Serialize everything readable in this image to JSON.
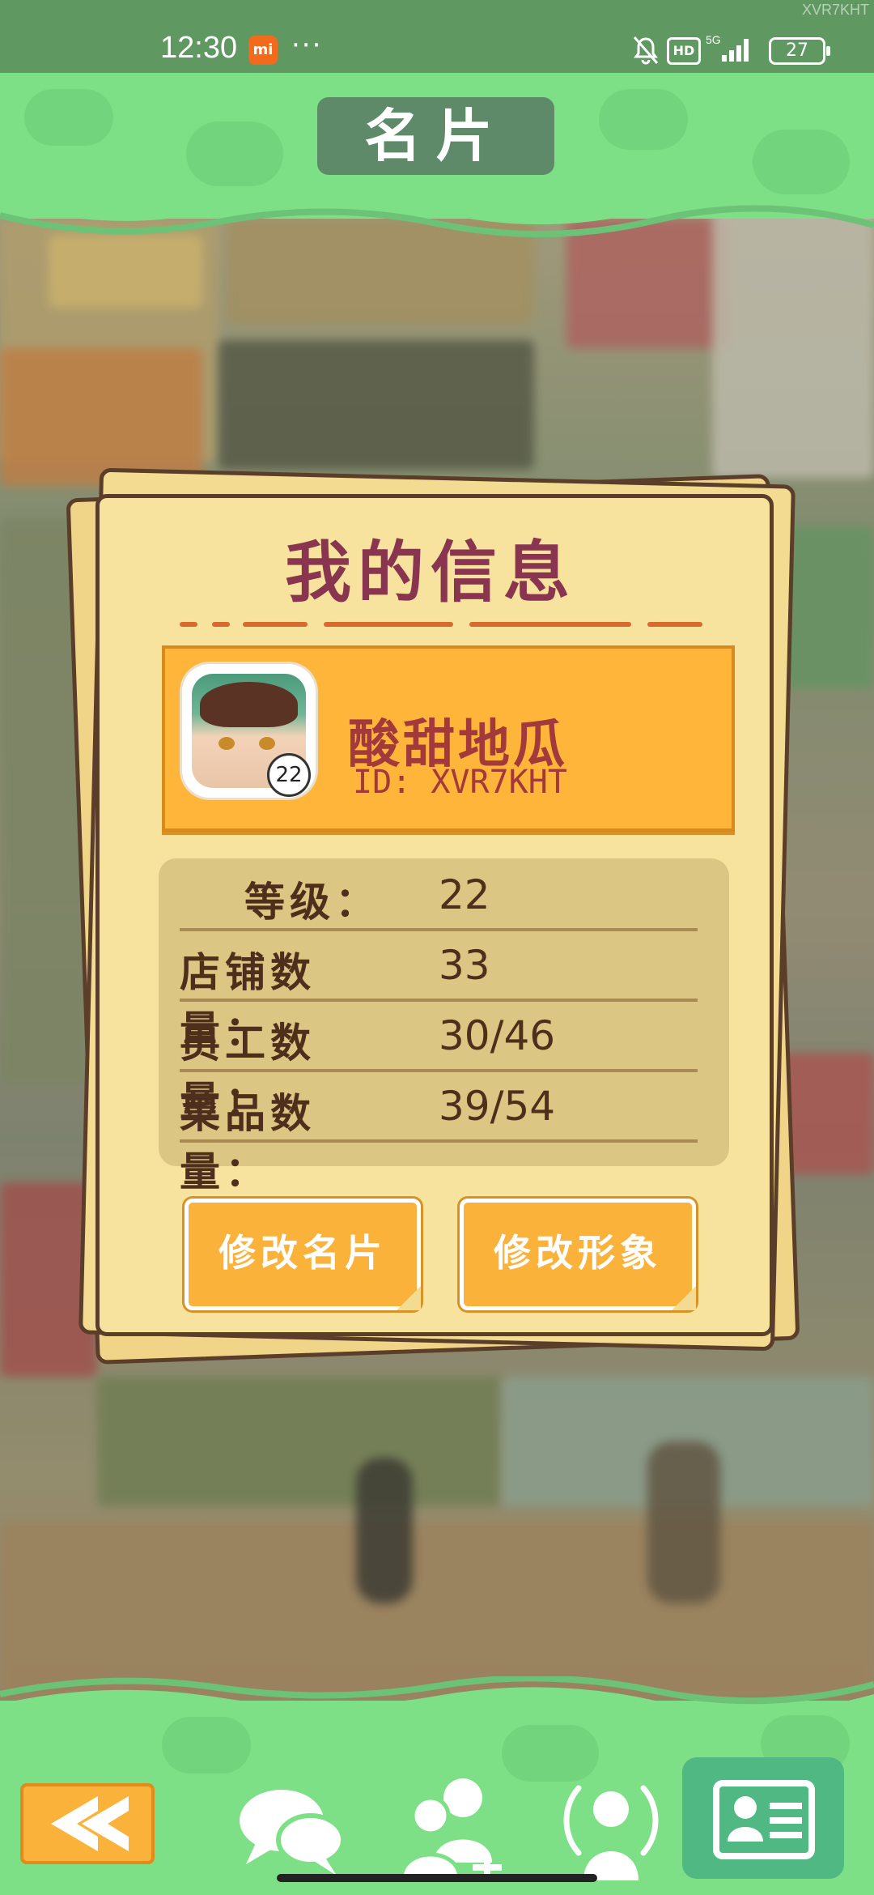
{
  "status_bar": {
    "time": "12:30",
    "app_badge": "mi",
    "more": "···",
    "hd": "HD",
    "network": "5G",
    "battery": "27"
  },
  "watermark": "XVR7KHT",
  "header": {
    "title": "名片"
  },
  "card": {
    "title": "我的信息",
    "profile": {
      "name": "酸甜地瓜",
      "id": "ID: XVR7KHT",
      "avatar_level": "22"
    },
    "stats": [
      {
        "label": "等级：",
        "value": "22"
      },
      {
        "label": "店铺数量：",
        "value": "33"
      },
      {
        "label": "员工数量：",
        "value": "30/46"
      },
      {
        "label": "菜品数量：",
        "value": "39/54"
      }
    ],
    "buttons": {
      "edit_card": "修改名片",
      "edit_avatar": "修改形象"
    }
  },
  "bottom_nav": {
    "icons": [
      "back-arrow-icon",
      "chat-bubbles-icon",
      "add-friend-icon",
      "nearby-broadcast-icon",
      "business-card-icon"
    ]
  },
  "colors": {
    "accent_green": "#7de086",
    "title_plate": "#5f8a6a",
    "paper": "#f7e39e",
    "orange": "#ffb43a",
    "name_red": "#a23a3c",
    "title_maroon": "#8a3550"
  }
}
